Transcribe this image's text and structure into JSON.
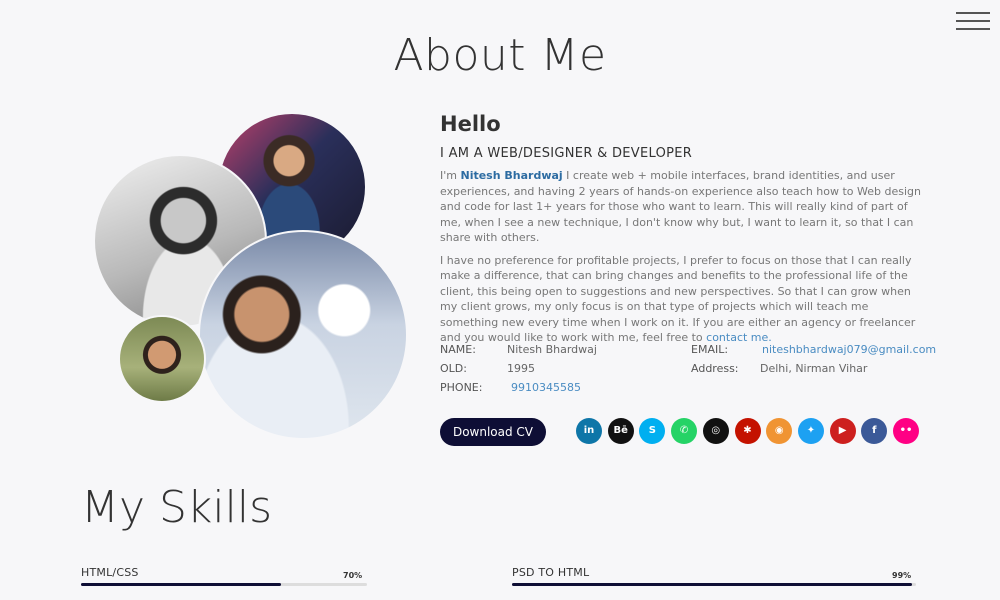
{
  "page_title": "About Me",
  "menu": {
    "icon": "hamburger-menu-icon"
  },
  "about": {
    "hello": "Hello",
    "role": "I AM A WEB/DESIGNER & DEVELOPER",
    "para1_prefix": "I'm ",
    "para1_name": "Nitesh Bhardwaj",
    "para1_rest": " I create web + mobile interfaces, brand identities, and user experiences, and having 2 years of hands-on experience also teach how to Web design and code for last 1+ years for those who want to learn. This will really kind of part of me, when I see a new technique, I don't know why but, I want to learn it, so that I can share with others.",
    "para2_text": "I have no preference for profitable projects, I prefer to focus on those that I can really make a difference, that can bring changes and benefits to the professional life of the client, this being open to suggestions and new perspectives. So that I can grow when my client grows, my only focus is on that type of projects which will teach me something new every time when I work on it. If you are either an agency or freelancer and you would like to work with me, feel free to ",
    "para2_link": "contact me."
  },
  "info": {
    "name_label": "NAME:",
    "name_value": "Nitesh Bhardwaj",
    "old_label": "OLD:",
    "old_value": "1995",
    "phone_label": "PHONE:",
    "phone_value": "9910345585",
    "email_label": "EMAIL:",
    "email_value": "niteshbhardwaj079@gmail.com",
    "address_label": "Address:",
    "address_value": "Delhi, Nirman Vihar"
  },
  "cv_button": "Download CV",
  "socials": [
    {
      "name": "linkedin-icon",
      "glyph": "in",
      "color": "#0e76a8"
    },
    {
      "name": "behance-icon",
      "glyph": "Bē",
      "color": "#111111"
    },
    {
      "name": "skype-icon",
      "glyph": "S",
      "color": "#00aff0"
    },
    {
      "name": "whatsapp-icon",
      "glyph": "✆",
      "color": "#25d366"
    },
    {
      "name": "dribbble-icon",
      "glyph": "◎",
      "color": "#111111"
    },
    {
      "name": "yelp-icon",
      "glyph": "✱",
      "color": "#c41200"
    },
    {
      "name": "instagram-icon",
      "glyph": "◉",
      "color": "#f09433"
    },
    {
      "name": "twitter-icon",
      "glyph": "✦",
      "color": "#1da1f2"
    },
    {
      "name": "youtube-icon",
      "glyph": "▶",
      "color": "#cd201f"
    },
    {
      "name": "facebook-icon",
      "glyph": "f",
      "color": "#3b5998"
    },
    {
      "name": "flickr-icon",
      "glyph": "••",
      "color": "#ff0084"
    }
  ],
  "skills_title": "My Skills",
  "skills": [
    {
      "name": "HTML/CSS",
      "percent_label": "70%",
      "percent": 70
    },
    {
      "name": "PSD TO HTML",
      "percent_label": "99%",
      "percent": 99
    }
  ]
}
